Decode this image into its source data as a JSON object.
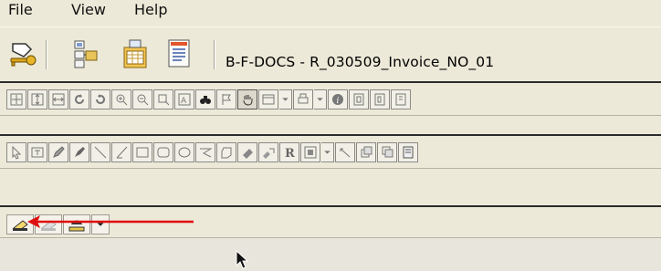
{
  "menu": {
    "items": [
      "File",
      "View",
      "Help"
    ]
  },
  "title_toolbar": {
    "document_title": "B-F-DOCS - R_030509_Invoice_NO_01",
    "icons": [
      "key-login-icon",
      "tree-structure-icon",
      "document-grid-icon",
      "properties-doc-icon"
    ]
  },
  "toolbar_view": {
    "icons": [
      "fit-all-icon",
      "fit-height-icon",
      "fit-width-icon",
      "rotate-left-icon",
      "rotate-right-icon",
      "zoom-in-icon",
      "zoom-out-icon",
      "zoom-window-icon",
      "zoom-text-icon",
      "find-binoculars-icon",
      "flag-icon",
      "pan-hand-icon",
      "page-layout-icon",
      "dropdown-icon",
      "print-icon",
      "dropdown-icon",
      "info-icon",
      "page-first-icon",
      "page-prev-icon",
      "page-next-icon"
    ]
  },
  "toolbar_draw": {
    "icons": [
      "select-arrow-icon",
      "text-box-icon",
      "pencil-icon",
      "marker-icon",
      "line-icon",
      "diagonal-line-icon",
      "rectangle-icon",
      "rounded-rectangle-icon",
      "ellipse-icon",
      "polyline-icon",
      "polygon-icon",
      "eraser-icon",
      "highlight-icon",
      "bold-icon",
      "stamp-icon",
      "dropdown-icon",
      "arrow-line-icon",
      "layer-icon",
      "layer-front-icon",
      "note-icon"
    ]
  },
  "toolbar_scan": {
    "icons": [
      "scanner-icon",
      "scanner-disabled-icon",
      "scanner-settings-icon",
      "dropdown-icon"
    ]
  },
  "colors": {
    "background": "#ece9d8",
    "annotation_arrow": "#e01010"
  }
}
